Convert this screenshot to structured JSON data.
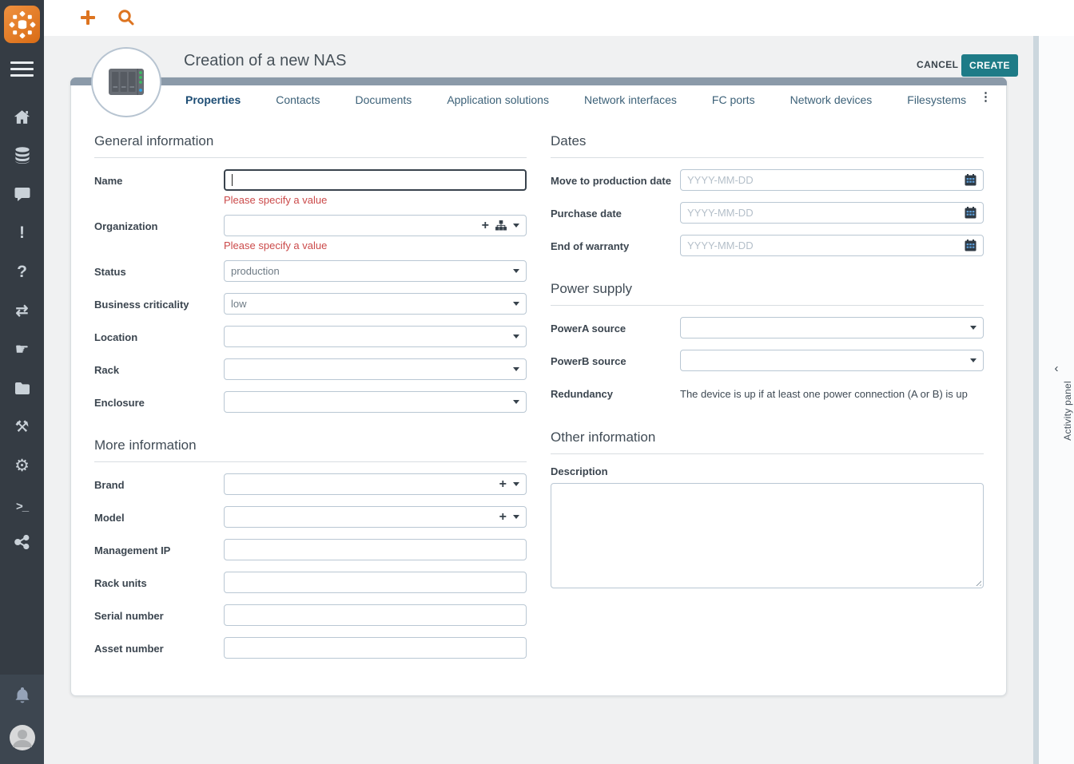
{
  "colors": {
    "accent_orange": "#dd7420",
    "teal": "#1e7b87",
    "sidebar_bg": "#353c44",
    "sidebar_bottom_bg": "#3d4650",
    "page_bg": "#f0f1f2",
    "card_strip": "#8b9aa9",
    "tab_active": "#1d4d74",
    "tab_inactive": "#3c6178",
    "heading": "#414c56",
    "label": "#3b454f",
    "error": "#cb4a4a",
    "border": "#b9c7d3",
    "placeholder": "#b4bfc9",
    "value_text": "#6e7b85",
    "title": "#48525a"
  },
  "sidebar": {
    "glyphs": {
      "alert": "!",
      "help": "?",
      "transfer": "⇄",
      "hand": "☛",
      "tools": "⚒",
      "settings": "⚙",
      "console": ">_"
    }
  },
  "header": {
    "title": "Creation of a new NAS",
    "cancel_label": "CANCEL",
    "create_label": "CREATE",
    "menu_glyph": "⋮"
  },
  "tabs": [
    {
      "label": "Properties",
      "active": true
    },
    {
      "label": "Contacts"
    },
    {
      "label": "Documents"
    },
    {
      "label": "Application solutions"
    },
    {
      "label": "Network interfaces"
    },
    {
      "label": "FC ports"
    },
    {
      "label": "Network devices"
    },
    {
      "label": "Filesystems"
    }
  ],
  "form": {
    "general": {
      "title": "General information",
      "name": {
        "label": "Name",
        "value": "",
        "error": "Please specify a value"
      },
      "organization": {
        "label": "Organization",
        "value": "",
        "error": "Please specify a value"
      },
      "status": {
        "label": "Status",
        "value": "production"
      },
      "business_criticality": {
        "label": "Business criticality",
        "value": "low"
      },
      "location": {
        "label": "Location",
        "value": ""
      },
      "rack": {
        "label": "Rack",
        "value": ""
      },
      "enclosure": {
        "label": "Enclosure",
        "value": ""
      }
    },
    "more": {
      "title": "More information",
      "brand": {
        "label": "Brand",
        "value": ""
      },
      "model": {
        "label": "Model",
        "value": ""
      },
      "management_ip": {
        "label": "Management IP",
        "value": ""
      },
      "rack_units": {
        "label": "Rack units",
        "value": ""
      },
      "serial_number": {
        "label": "Serial number",
        "value": ""
      },
      "asset_number": {
        "label": "Asset number",
        "value": ""
      }
    },
    "dates": {
      "title": "Dates",
      "move_to_production": {
        "label": "Move to production date",
        "placeholder": "YYYY-MM-DD"
      },
      "purchase": {
        "label": "Purchase date",
        "placeholder": "YYYY-MM-DD"
      },
      "end_of_warranty": {
        "label": "End of warranty",
        "placeholder": "YYYY-MM-DD"
      }
    },
    "power": {
      "title": "Power supply",
      "power_a": {
        "label": "PowerA source",
        "value": ""
      },
      "power_b": {
        "label": "PowerB source",
        "value": ""
      },
      "redundancy": {
        "label": "Redundancy",
        "value": "The device is up if at least one power connection (A or B) is up"
      }
    },
    "other": {
      "title": "Other information",
      "description": {
        "label": "Description",
        "value": ""
      }
    }
  },
  "activity_panel": {
    "label": "Activity panel",
    "collapse_glyph": "‹"
  }
}
